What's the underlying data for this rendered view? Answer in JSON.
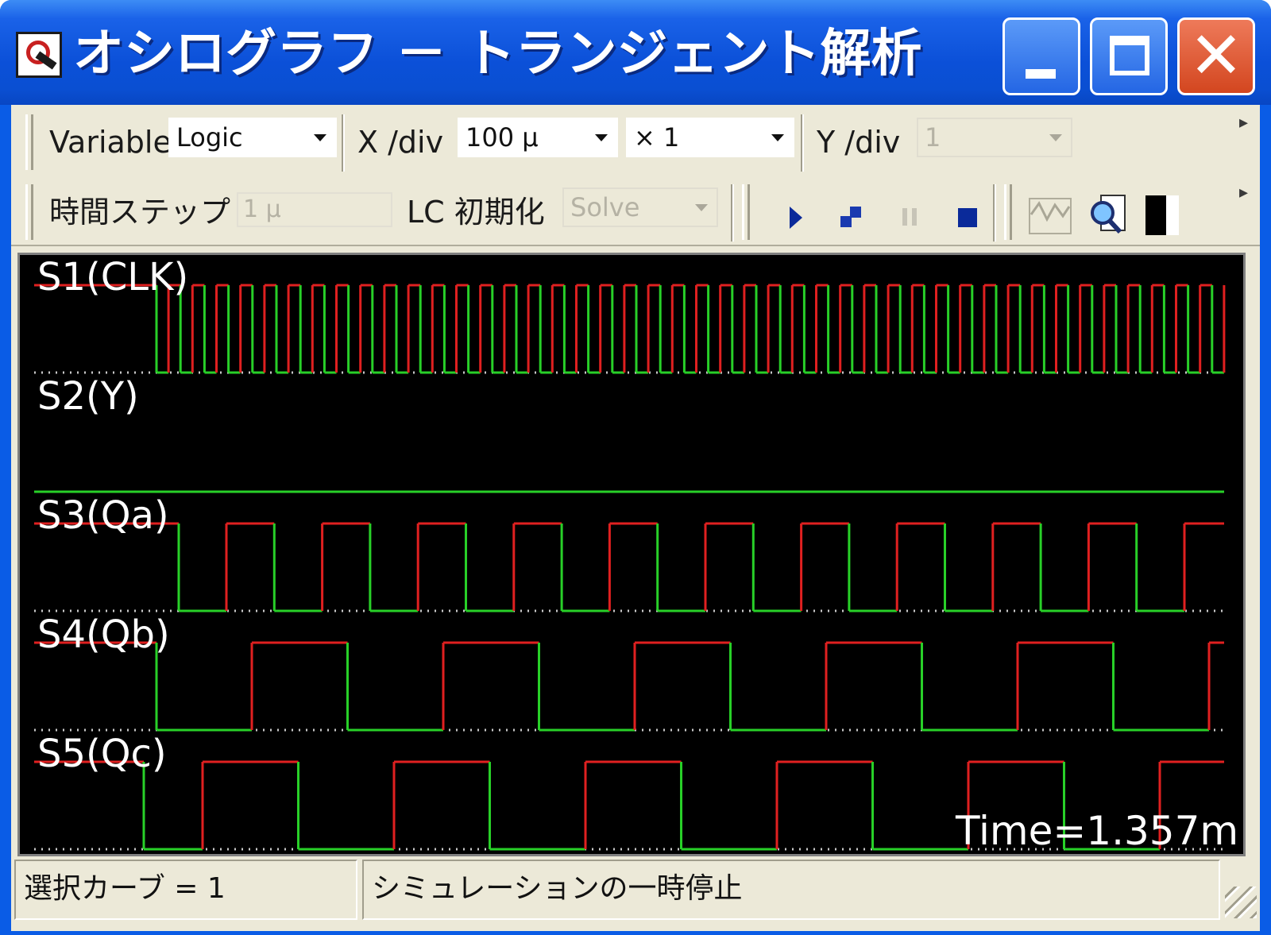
{
  "window": {
    "title": "オシログラフ － トランジェント解析",
    "icon": "oscilloscope-app-icon",
    "minimize_icon": "minimize-icon",
    "maximize_icon": "maximize-icon",
    "close_icon": "close-icon",
    "close_glyph": "✕"
  },
  "toolbar1": {
    "variable_label": "Variable",
    "variable_value": "Logic",
    "xdiv_label": "X /div",
    "xdiv_value": "100 μ",
    "multiplier_value": "× 1",
    "ydiv_label": "Y /div",
    "ydiv_value": "1"
  },
  "toolbar2": {
    "timestep_label": "時間ステップ",
    "timestep_value": "1 μ",
    "lc_init_label": "LC 初期化",
    "lc_init_value": "Solve",
    "controls": [
      "play-icon",
      "step-icon",
      "pause-icon",
      "stop-icon"
    ],
    "tools": [
      "curve-select-icon",
      "zoom-icon",
      "color-block-icon"
    ]
  },
  "scope": {
    "colors": {
      "background": "#000000",
      "high": "#e02020",
      "low": "#28d028",
      "baseline_dots": "#c8c8c8"
    },
    "channels": [
      {
        "id": "S1",
        "label": "S1(CLK)",
        "state": "clock"
      },
      {
        "id": "S2",
        "label": "S2(Y)",
        "state": "constant-low"
      },
      {
        "id": "S3",
        "label": "S3(Qa)",
        "state": "square"
      },
      {
        "id": "S4",
        "label": "S4(Qb)",
        "state": "square"
      },
      {
        "id": "S5",
        "label": "S5(Qc)",
        "state": "square"
      }
    ],
    "time_readout": "Time=1.357m"
  },
  "statusbar": {
    "selected_curve": "選択カーブ = 1",
    "sim_status": "シミュレーションの一時停止"
  }
}
